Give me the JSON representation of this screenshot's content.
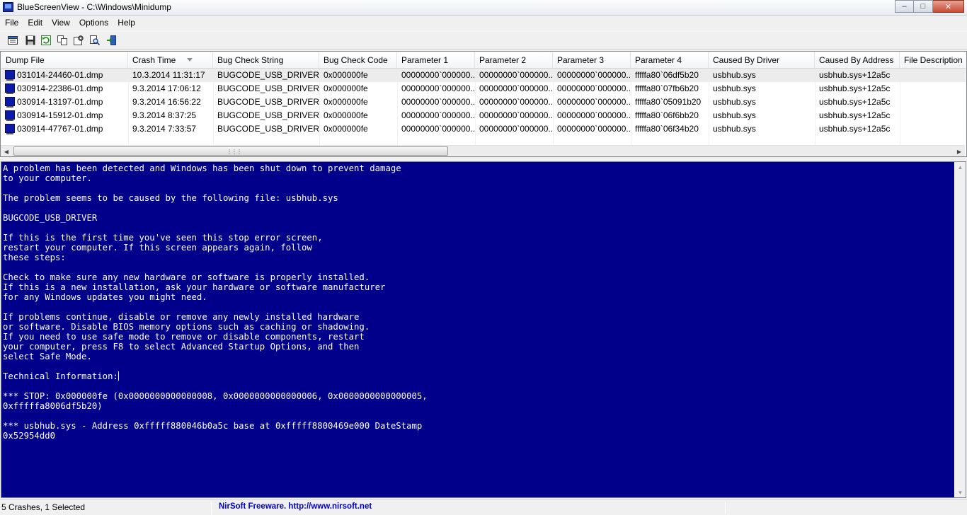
{
  "window": {
    "title": "BlueScreenView  -  C:\\Windows\\Minidump",
    "minimize": "–",
    "maximize": "□",
    "close": "✕"
  },
  "menu": [
    "File",
    "Edit",
    "View",
    "Options",
    "Help"
  ],
  "toolbar": [
    "properties-icon",
    "save-icon",
    "refresh-icon",
    "copy-icon",
    "advanced-options-icon",
    "find-icon",
    "exit-icon"
  ],
  "table": {
    "columns": [
      "Dump File",
      "Crash Time",
      "Bug Check String",
      "Bug Check Code",
      "Parameter 1",
      "Parameter 2",
      "Parameter 3",
      "Parameter 4",
      "Caused By Driver",
      "Caused By Address",
      "File Description"
    ],
    "sort_column": "Crash Time",
    "rows": [
      [
        "031014-24460-01.dmp",
        "10.3.2014 11:31:17",
        "BUGCODE_USB_DRIVER",
        "0x000000fe",
        "00000000`000000...",
        "00000000`000000...",
        "00000000`000000...",
        "fffffa80`06df5b20",
        "usbhub.sys",
        "usbhub.sys+12a5c",
        ""
      ],
      [
        "030914-22386-01.dmp",
        "9.3.2014 17:06:12",
        "BUGCODE_USB_DRIVER",
        "0x000000fe",
        "00000000`000000...",
        "00000000`000000...",
        "00000000`000000...",
        "fffffa80`07fb6b20",
        "usbhub.sys",
        "usbhub.sys+12a5c",
        ""
      ],
      [
        "030914-13197-01.dmp",
        "9.3.2014 16:56:22",
        "BUGCODE_USB_DRIVER",
        "0x000000fe",
        "00000000`000000...",
        "00000000`000000...",
        "00000000`000000...",
        "fffffa80`05091b20",
        "usbhub.sys",
        "usbhub.sys+12a5c",
        ""
      ],
      [
        "030914-15912-01.dmp",
        "9.3.2014 8:37:25",
        "BUGCODE_USB_DRIVER",
        "0x000000fe",
        "00000000`000000...",
        "00000000`000000...",
        "00000000`000000...",
        "fffffa80`06f6bb20",
        "usbhub.sys",
        "usbhub.sys+12a5c",
        ""
      ],
      [
        "030914-47767-01.dmp",
        "9.3.2014 7:33:57",
        "BUGCODE_USB_DRIVER",
        "0x000000fe",
        "00000000`000000...",
        "00000000`000000...",
        "00000000`000000...",
        "fffffa80`06f34b20",
        "usbhub.sys",
        "usbhub.sys+12a5c",
        ""
      ]
    ],
    "selected_row": 0
  },
  "bsod": {
    "lines": [
      "A problem has been detected and Windows has been shut down to prevent damage",
      "to your computer.",
      "",
      "The problem seems to be caused by the following file: usbhub.sys",
      "",
      "BUGCODE_USB_DRIVER",
      "",
      "If this is the first time you've seen this stop error screen,",
      "restart your computer. If this screen appears again, follow",
      "these steps:",
      "",
      "Check to make sure any new hardware or software is properly installed.",
      "If this is a new installation, ask your hardware or software manufacturer",
      "for any Windows updates you might need.",
      "",
      "If problems continue, disable or remove any newly installed hardware",
      "or software. Disable BIOS memory options such as caching or shadowing.",
      "If you need to use safe mode to remove or disable components, restart",
      "your computer, press F8 to select Advanced Startup Options, and then",
      "select Safe Mode.",
      "",
      "Technical Information:",
      "",
      "*** STOP: 0x000000fe (0x0000000000000008, 0x0000000000000006, 0x0000000000000005,",
      "0xfffffa8006df5b20)",
      "",
      "*** usbhub.sys - Address 0xfffff880046b0a5c base at 0xfffff8800469e000 DateStamp",
      "0x52954dd0"
    ],
    "caret_line": 21,
    "background": "#00008b",
    "foreground": "#ffffff"
  },
  "status": {
    "count": "5 Crashes, 1 Selected",
    "credit": "NirSoft Freeware.  http://www.nirsoft.net"
  }
}
